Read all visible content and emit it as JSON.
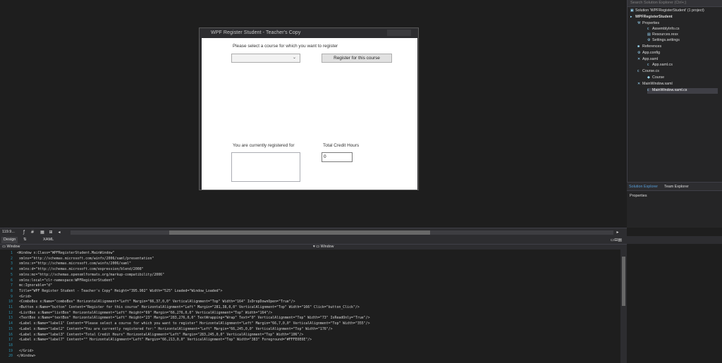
{
  "designer": {
    "window_title": "WPF Register Student - Teacher's Copy",
    "prompt_label": "Please select a course for which you want to register",
    "register_button": "Register for this course",
    "registered_label": "You are currently registered for",
    "total_credit_label": "Total Credit Hours",
    "credit_value": "0"
  },
  "solution_explorer": {
    "search_placeholder": "Search Solution Explorer (Ctrl+;)",
    "items": [
      {
        "label": "Solution 'WPFRegisterStudent' (1 project)",
        "icon": "solution-icon"
      },
      {
        "label": "WPFRegisterStudent",
        "icon": "project-icon"
      },
      {
        "label": "Properties",
        "icon": "wrench-icon"
      },
      {
        "label": "AssemblyInfo.cs",
        "icon": "csharp-file-icon"
      },
      {
        "label": "Resources.resx",
        "icon": "resources-icon"
      },
      {
        "label": "Settings.settings",
        "icon": "settings-icon"
      },
      {
        "label": "References",
        "icon": "references-icon"
      },
      {
        "label": "App.config",
        "icon": "config-icon"
      },
      {
        "label": "App.xaml",
        "icon": "xaml-file-icon"
      },
      {
        "label": "App.xaml.cs",
        "icon": "csharp-file-icon"
      },
      {
        "label": "Course.cs",
        "icon": "csharp-file-icon"
      },
      {
        "label": "Course",
        "icon": "class-icon"
      },
      {
        "label": "MainWindow.xaml",
        "icon": "xaml-file-icon"
      },
      {
        "label": "MainWindow.xaml.cs",
        "icon": "csharp-file-icon"
      }
    ],
    "tab_solution": "Solution Explorer",
    "tab_team": "Team Explorer",
    "properties_label": "Properties"
  },
  "zoom_bar": {
    "zoom": "119.9..."
  },
  "tabs": {
    "design": "Design",
    "xaml": "XAML"
  },
  "breadcrumb": {
    "left": "Window",
    "right": "Window"
  },
  "code_lines": [
    "<Window x:Class=\"WPFRegisterStudent.MainWindow\"",
    "        xmlns=\"http://schemas.microsoft.com/winfx/2006/xaml/presentation\"",
    "        xmlns:x=\"http://schemas.microsoft.com/winfx/2006/xaml\"",
    "        xmlns:d=\"http://schemas.microsoft.com/expression/blend/2008\"",
    "        xmlns:mc=\"http://schemas.openxmlformats.org/markup-compatibility/2006\"",
    "        xmlns:local=\"clr-namespace:WPFRegisterStudent\"",
    "        mc:Ignorable=\"d\"",
    "        Title=\"WPF Register Student - Teacher's Copy\" Height=\"395.902\" Width=\"525\" Loaded=\"Window_Loaded\">",
    "    <Grid>",
    "        <ComboBox x:Name=\"comboBox\" HorizontalAlignment=\"Left\" Margin=\"66,37,0,0\" VerticalAlignment=\"Top\" Width=\"164\" IsDropDownOpen=\"True\"/>",
    "        <Button x:Name=\"button\" Content=\"Register for this course\" HorizontalAlignment=\"Left\" Margin=\"281,38,0,0\" VerticalAlignment=\"Top\" Width=\"166\" Click=\"button_Click\"/>",
    "        <ListBox x:Name=\"listBox\" HorizontalAlignment=\"Left\" Height=\"69\" Margin=\"66,276,0,0\" VerticalAlignment=\"Top\" Width=\"164\"/>",
    "        <TextBox x:Name=\"textBox\" HorizontalAlignment=\"Left\" Height=\"23\" Margin=\"283,276,0,0\" TextWrapping=\"Wrap\" Text=\"0\" VerticalAlignment=\"Top\" Width=\"73\" IsReadOnly=\"True\"/>",
    "        <Label x:Name=\"label1\" Content=\"Please select a course for which you want to register\" HorizontalAlignment=\"Left\" Margin=\"66,7,0,0\" VerticalAlignment=\"Top\" Width=\"355\"/>",
    "        <Label x:Name=\"label2\" Content=\"You are currently registered for:\" HorizontalAlignment=\"Left\" Margin=\"66,245,0,0\" VerticalAlignment=\"Top\" Width=\"176\"/>",
    "        <Label x:Name=\"label3\" Content=\"Total Credit Hours\" HorizontalAlignment=\"Left\" Margin=\"283,245,0,0\" VerticalAlignment=\"Top\" Width=\"106\"/>",
    "        <Label x:Name=\"label7\" Content=\"\" HorizontalAlignment=\"Left\" Margin=\"66,213,0,0\" VerticalAlignment=\"Top\" Width=\"383\" Foreground=\"#FFFE0E0E\"/>",
    "",
    "    </Grid>",
    "</Window>"
  ],
  "colors": {
    "background": "#1e1e1e",
    "panel": "#252526",
    "line_number": "#2b91af"
  }
}
